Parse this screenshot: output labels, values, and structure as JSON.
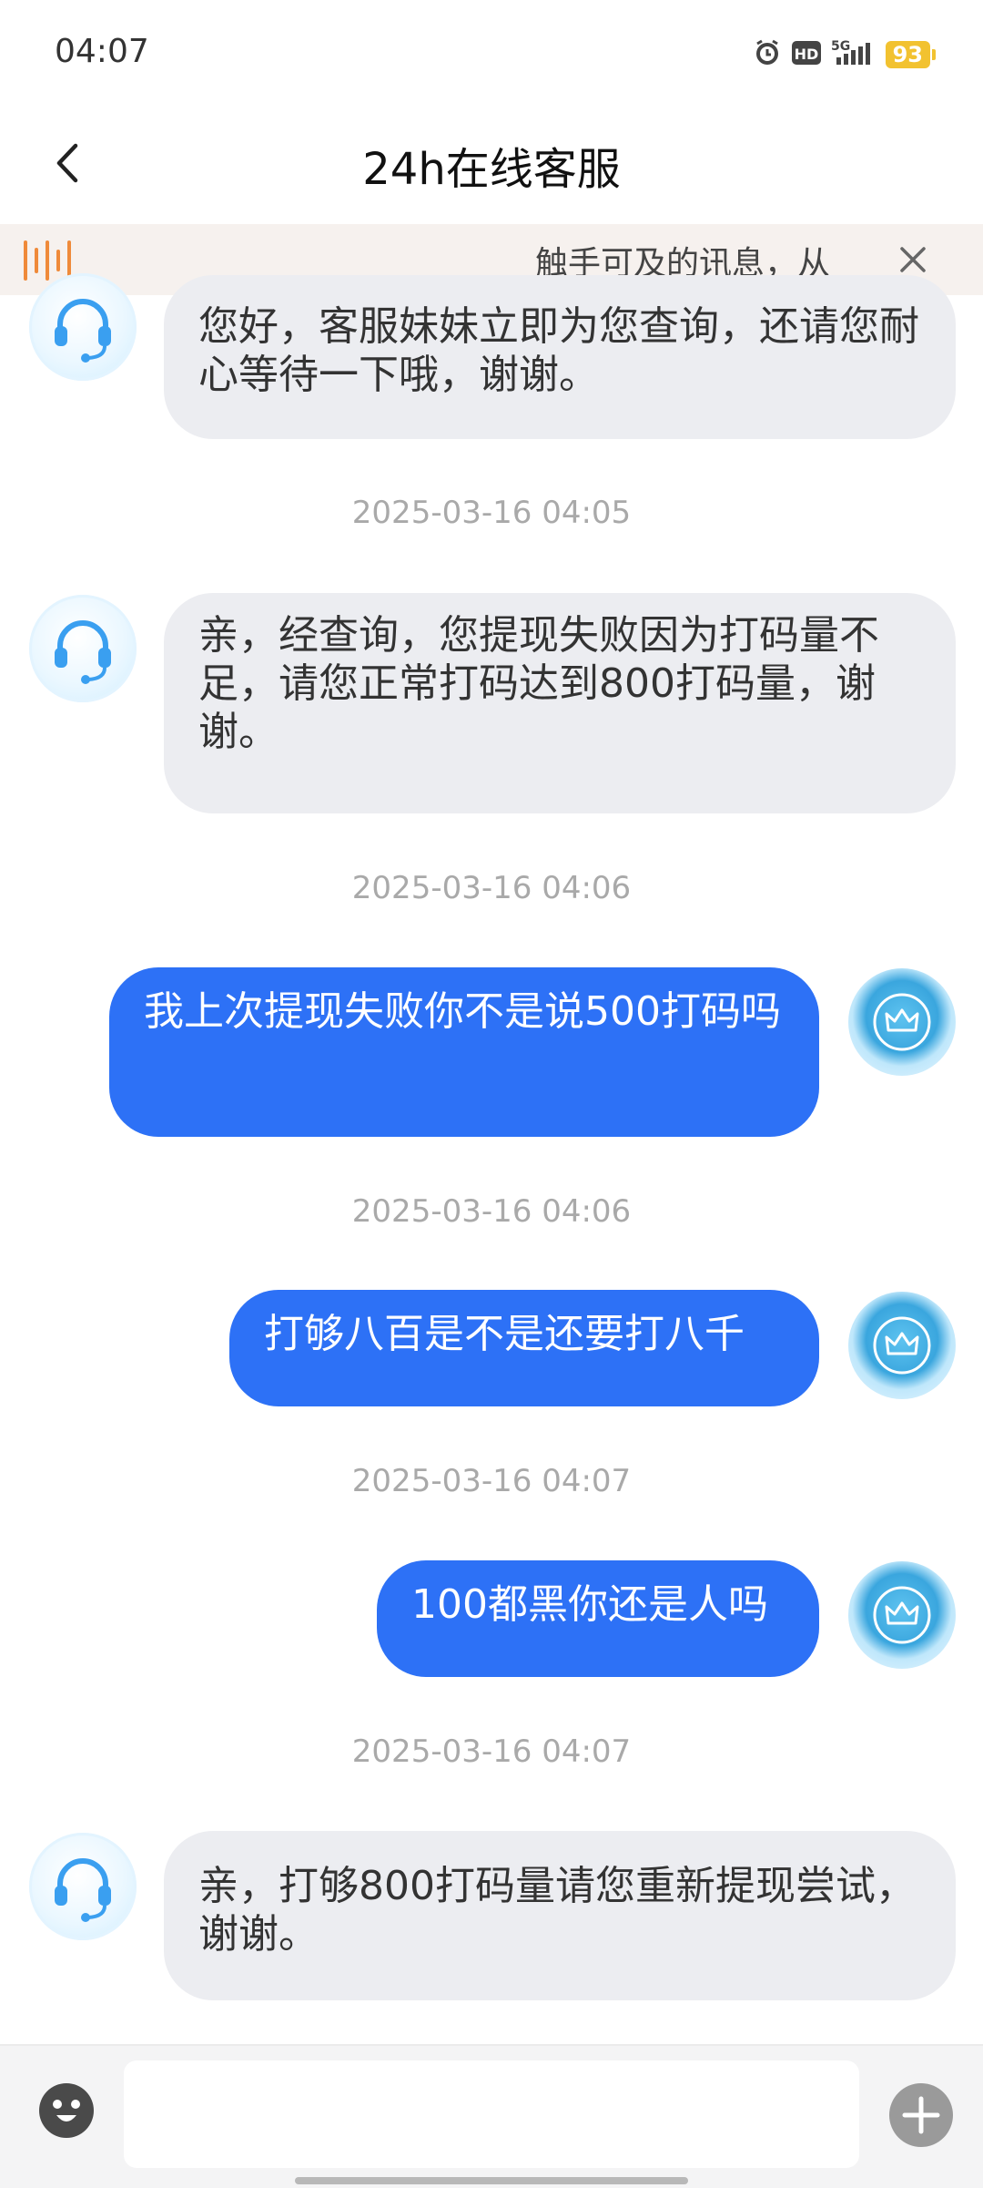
{
  "status_bar": {
    "time": "04:07",
    "signal_label": "5G",
    "hd_label": "HD",
    "battery": "93",
    "icons": [
      "alarm-icon",
      "hd-icon",
      "signal-5g-icon",
      "battery-icon"
    ]
  },
  "header": {
    "title": "24h在线客服",
    "back_icon": "chevron-left-icon"
  },
  "notice": {
    "text": "触手可及的讯息，从",
    "icon": "voice-wave-icon",
    "close_icon": "close-icon"
  },
  "messages": [
    {
      "sender": "agent",
      "text": "您好，客服妹妹立即为您查询，还请您耐心等待一下哦，谢谢。"
    },
    {
      "timestamp": "2025-03-16 04:05"
    },
    {
      "sender": "agent",
      "text": "亲，经查询，您提现失败因为打码量不足，请您正常打码达到800打码量，谢谢。"
    },
    {
      "timestamp": "2025-03-16 04:06"
    },
    {
      "sender": "user",
      "text": "我上次提现失败你不是说500打码吗"
    },
    {
      "timestamp": "2025-03-16 04:06"
    },
    {
      "sender": "user",
      "text": "打够八百是不是还要打八千"
    },
    {
      "timestamp": "2025-03-16 04:07"
    },
    {
      "sender": "user",
      "text": "100都黑你还是人吗"
    },
    {
      "timestamp": "2025-03-16 04:07"
    },
    {
      "sender": "agent",
      "text": "亲，打够800打码量请您重新提现尝试，谢谢。"
    }
  ],
  "input_bar": {
    "placeholder": "",
    "emoji_icon": "emoji-icon",
    "add_icon": "plus-circle-icon"
  },
  "colors": {
    "user_bubble": "#2d71f6",
    "agent_bubble": "#ecedf1",
    "notice_bg": "#f6f1ee",
    "timestamp": "#a9a9a9",
    "battery": "#f2c230"
  }
}
